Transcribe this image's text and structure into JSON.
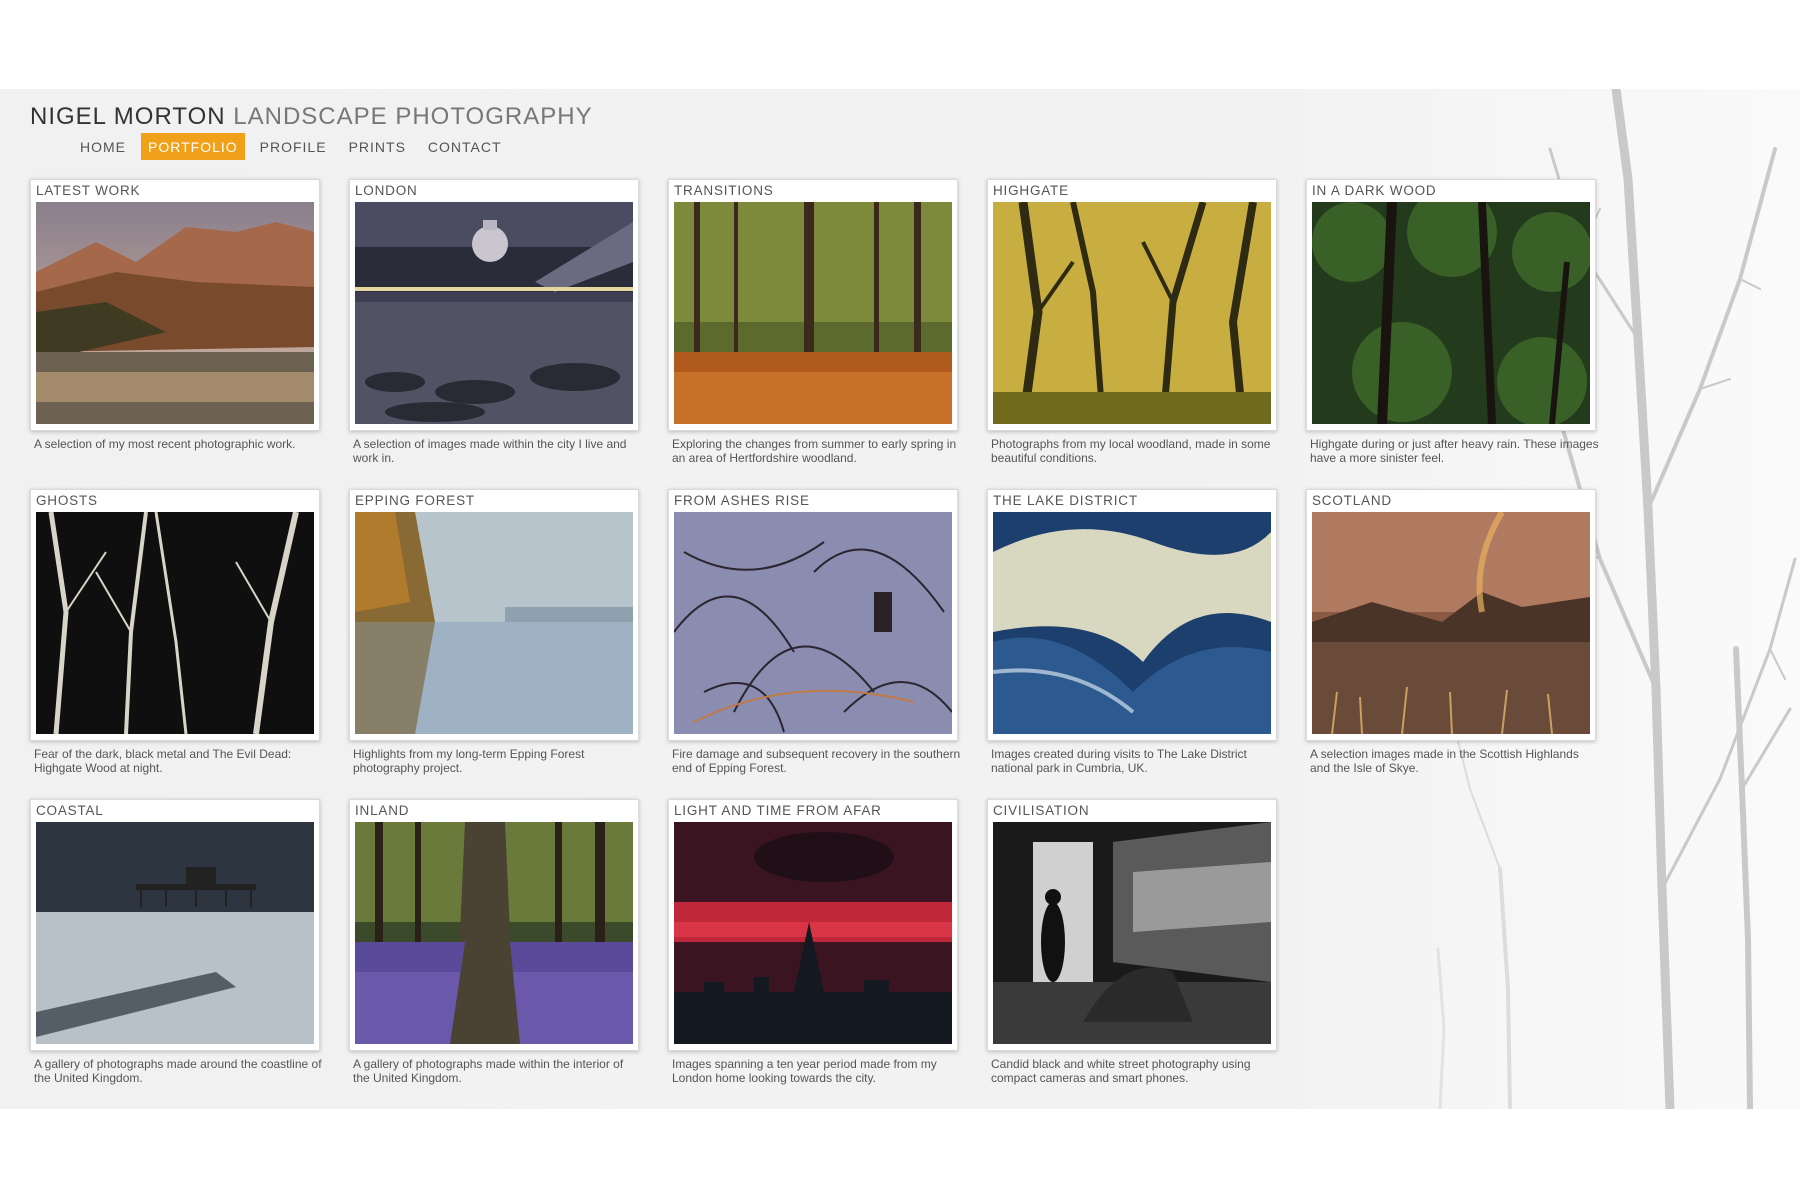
{
  "site": {
    "title_main": "NIGEL MORTON",
    "title_sub": "LANDSCAPE PHOTOGRAPHY"
  },
  "nav": {
    "items": [
      {
        "label": "HOME",
        "active": false
      },
      {
        "label": "PORTFOLIO",
        "active": true
      },
      {
        "label": "PROFILE",
        "active": false
      },
      {
        "label": "PRINTS",
        "active": false
      },
      {
        "label": "CONTACT",
        "active": false
      }
    ]
  },
  "colors": {
    "accent": "#f0a019",
    "background": "#f2f2f2",
    "text": "#555555"
  },
  "galleries": [
    {
      "title": "LATEST WORK",
      "description": "A selection of my most recent photographic work.",
      "image": "mountain-lake-image"
    },
    {
      "title": "LONDON",
      "description": "A selection of images made within the city I live and work in.",
      "image": "city-night-river-image"
    },
    {
      "title": "TRANSITIONS",
      "description": "Exploring the changes from summer to early spring in an area of Hertfordshire woodland.",
      "image": "autumn-forest-image"
    },
    {
      "title": "HIGHGATE",
      "description": "Photographs from my local woodland, made in some beautiful conditions.",
      "image": "golden-woodland-image"
    },
    {
      "title": "IN A DARK WOOD",
      "description": "Highgate during or just after heavy rain. These images have a more sinister feel.",
      "image": "dark-green-wood-image"
    },
    {
      "title": "GHOSTS",
      "description": "Fear of the dark, black metal and The Evil Dead: Highgate Wood at night.",
      "image": "night-trees-image"
    },
    {
      "title": "EPPING FOREST",
      "description": "Highlights from my long-term Epping Forest photography project.",
      "image": "misty-lake-image"
    },
    {
      "title": "FROM ASHES RISE",
      "description": "Fire damage and subsequent recovery in the southern end of Epping Forest.",
      "image": "burnt-brambles-image"
    },
    {
      "title": "THE LAKE DISTRICT",
      "description": "Images created during visits to The Lake District national park in Cumbria, UK.",
      "image": "rushing-water-image"
    },
    {
      "title": "SCOTLAND",
      "description": "A selection images made in the Scottish Highlands and the Isle of Skye.",
      "image": "rainbow-loch-image"
    },
    {
      "title": "COASTAL",
      "description": "A gallery of photographs made around the coastline of the United Kingdom.",
      "image": "pier-seascape-image"
    },
    {
      "title": "INLAND",
      "description": "A gallery of photographs made within the interior of the United Kingdom.",
      "image": "bluebell-wood-image"
    },
    {
      "title": "LIGHT AND TIME FROM AFAR",
      "description": "Images spanning a ten year period made from my London home looking towards the city.",
      "image": "red-sky-skyline-image"
    },
    {
      "title": "CIVILISATION",
      "description": "Candid black and white street photography using compact cameras and smart phones.",
      "image": "street-bw-image"
    }
  ]
}
